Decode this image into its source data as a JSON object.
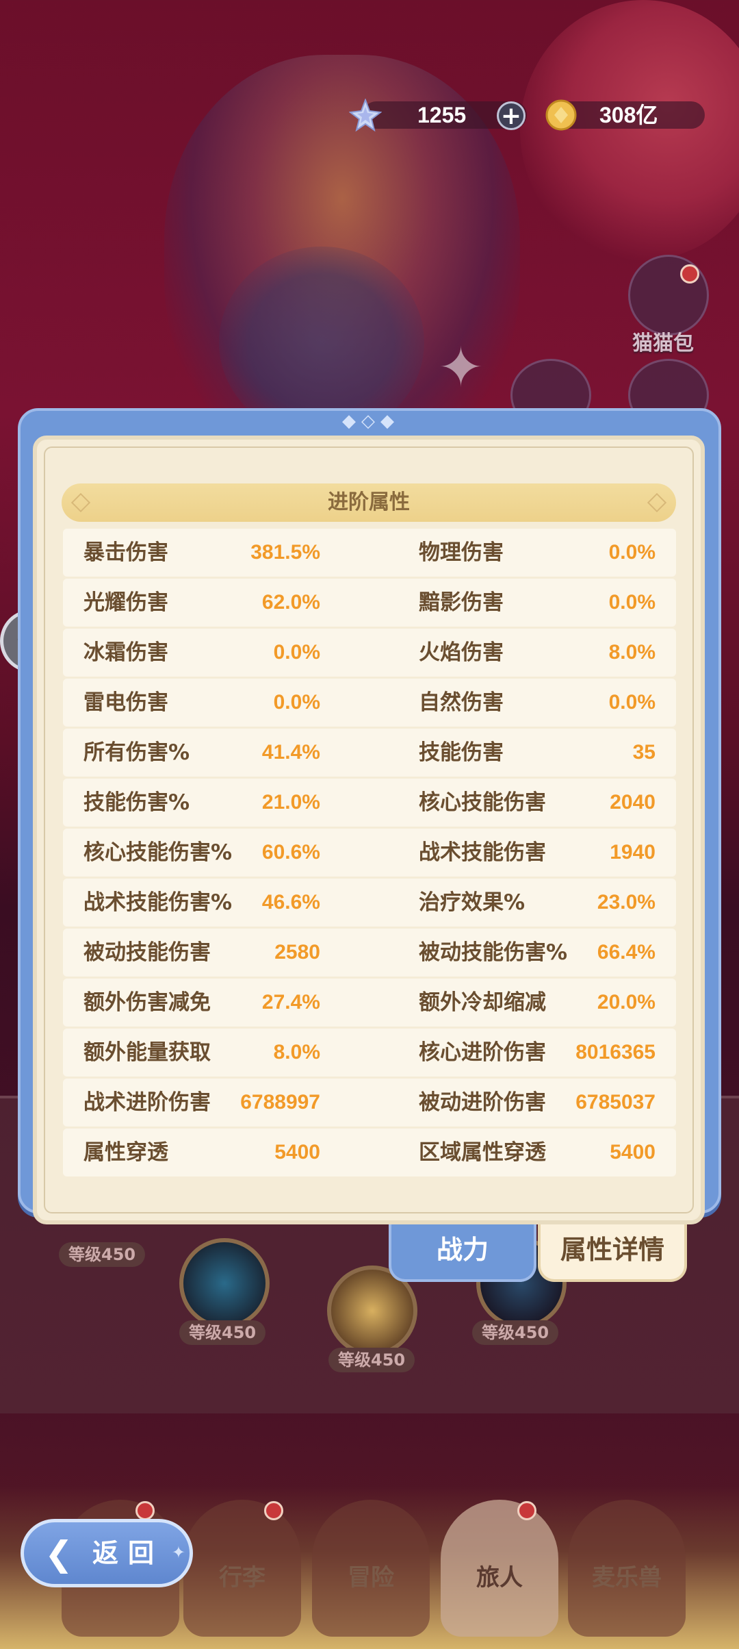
{
  "currency": {
    "gems": "1255",
    "coins": "308亿"
  },
  "side": {
    "cat_bag": "猫猫包"
  },
  "skill_levels": [
    "等级450",
    "等级450",
    "等级450",
    "等级450"
  ],
  "panel": {
    "section_title": "进阶属性",
    "rows": [
      {
        "left_label": "暴击伤害",
        "left_value": "381.5%",
        "right_label": "物理伤害",
        "right_value": "0.0%"
      },
      {
        "left_label": "光耀伤害",
        "left_value": "62.0%",
        "right_label": "黯影伤害",
        "right_value": "0.0%"
      },
      {
        "left_label": "冰霜伤害",
        "left_value": "0.0%",
        "right_label": "火焰伤害",
        "right_value": "8.0%"
      },
      {
        "left_label": "雷电伤害",
        "left_value": "0.0%",
        "right_label": "自然伤害",
        "right_value": "0.0%"
      },
      {
        "left_label": "所有伤害%",
        "left_value": "41.4%",
        "right_label": "技能伤害",
        "right_value": "35"
      },
      {
        "left_label": "技能伤害%",
        "left_value": "21.0%",
        "right_label": "核心技能伤害",
        "right_value": "2040"
      },
      {
        "left_label": "核心技能伤害%",
        "left_value": "60.6%",
        "right_label": "战术技能伤害",
        "right_value": "1940"
      },
      {
        "left_label": "战术技能伤害%",
        "left_value": "46.6%",
        "right_label": "治疗效果%",
        "right_value": "23.0%"
      },
      {
        "left_label": "被动技能伤害",
        "left_value": "2580",
        "right_label": "被动技能伤害%",
        "right_value": "66.4%"
      },
      {
        "left_label": "额外伤害减免",
        "left_value": "27.4%",
        "right_label": "额外冷却缩减",
        "right_value": "20.0%"
      },
      {
        "left_label": "额外能量获取",
        "left_value": "8.0%",
        "right_label": "核心进阶伤害",
        "right_value": "8016365"
      },
      {
        "left_label": "战术进阶伤害",
        "left_value": "6788997",
        "right_label": "被动进阶伤害",
        "right_value": "6785037"
      },
      {
        "left_label": "属性穿透",
        "left_value": "5400",
        "right_label": "区域属性穿透",
        "right_value": "5400"
      }
    ]
  },
  "tabs": {
    "power": "战力",
    "detail": "属性详情"
  },
  "back_button": "返回",
  "nav": {
    "luggage": "行李",
    "adventure": "冒险",
    "traveler": "旅人",
    "pet": "麦乐兽"
  },
  "colors": {
    "value_orange": "#f29a28",
    "label_brown": "#6a4e30",
    "dialog_blue": "#6f98d8",
    "panel_cream": "#f5ecd7"
  }
}
